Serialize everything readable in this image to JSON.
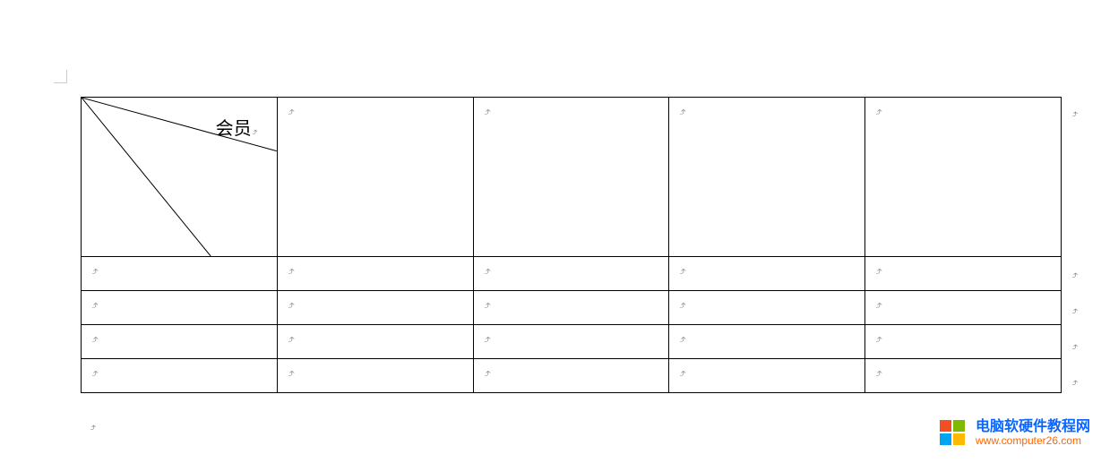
{
  "glyphs": {
    "paragraph_mark": "⤶"
  },
  "diagonal_header": {
    "top_right_label": "会员"
  },
  "watermark": {
    "title": "电脑软硬件教程网",
    "url": "www.computer26.com"
  },
  "table": {
    "columns": 5,
    "rows": [
      {
        "kind": "header",
        "cells": [
          "",
          "",
          "",
          "",
          ""
        ]
      },
      {
        "kind": "body",
        "cells": [
          "",
          "",
          "",
          "",
          ""
        ]
      },
      {
        "kind": "body",
        "cells": [
          "",
          "",
          "",
          "",
          ""
        ]
      },
      {
        "kind": "body",
        "cells": [
          "",
          "",
          "",
          "",
          ""
        ]
      },
      {
        "kind": "body",
        "cells": [
          "",
          "",
          "",
          "",
          ""
        ]
      }
    ]
  },
  "outside_marks": {
    "right_of_rows": [
      "⤶",
      "⤶",
      "⤶",
      "⤶",
      "⤶"
    ],
    "below_table": "⤶"
  }
}
